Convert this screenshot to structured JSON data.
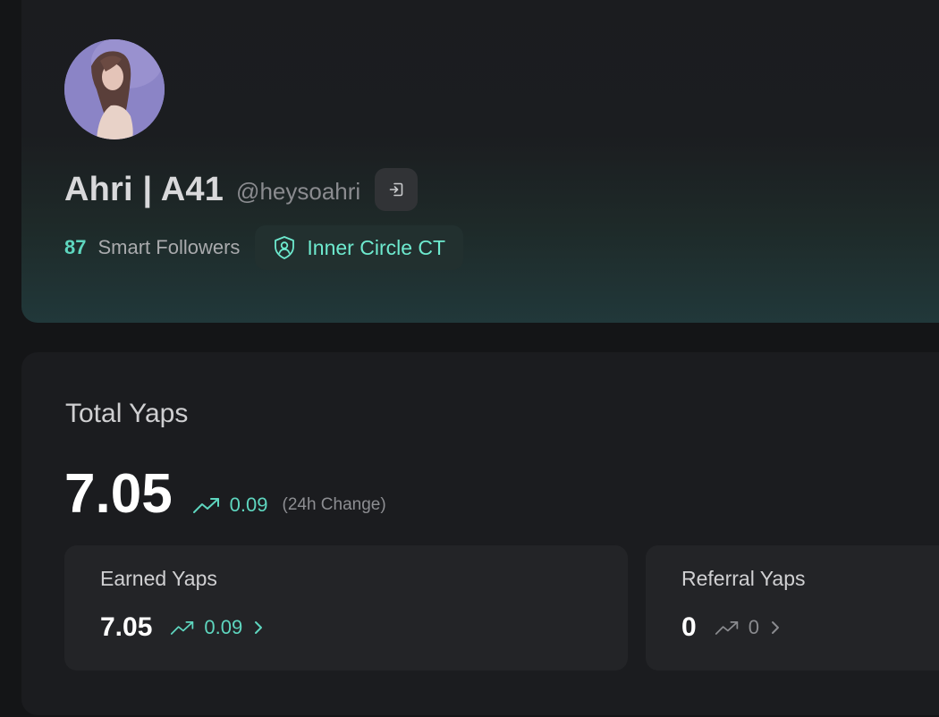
{
  "profile": {
    "display_name": "Ahri | A41",
    "handle": "@heysoahri",
    "smart_followers_count": "87",
    "smart_followers_label": "Smart Followers",
    "badge_label": "Inner Circle CT",
    "avatar_icon": "user-avatar-photo",
    "logout_icon": "logout-icon",
    "badge_icon": "shield-user-icon"
  },
  "yaps": {
    "title": "Total Yaps",
    "total_value": "7.05",
    "total_change": "0.09",
    "total_change_label": "(24h Change)",
    "trend_icon": "trending-up-icon",
    "earned": {
      "title": "Earned Yaps",
      "value": "7.05",
      "change": "0.09"
    },
    "referral": {
      "title": "Referral Yaps",
      "value": "0",
      "change": "0"
    }
  },
  "colors": {
    "accent": "#5ed6bf",
    "badge_text": "#6eeacf",
    "background": "#141517",
    "card": "#1b1c1f",
    "sub_card": "#232427",
    "muted": "#8a8b8f"
  }
}
